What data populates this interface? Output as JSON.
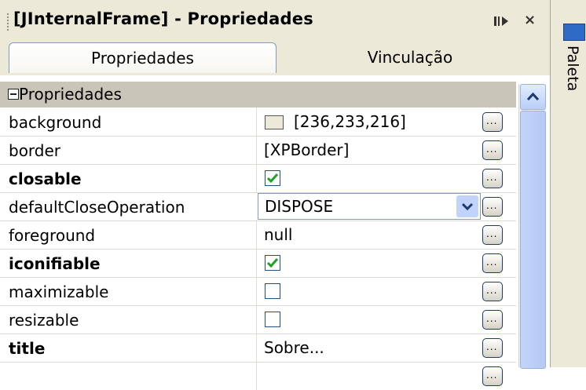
{
  "window": {
    "title": "[JInternalFrame] - Propriedades",
    "controls": {
      "minimize_icon": "minimize-dock-icon",
      "close_label": "×"
    }
  },
  "tabs": [
    {
      "label": "Propriedades",
      "active": true
    },
    {
      "label": "Vinculação",
      "active": false
    }
  ],
  "category": {
    "label": "Propriedades",
    "expanded": true
  },
  "properties": [
    {
      "name": "background",
      "bold": false,
      "kind": "color",
      "value": "[236,233,216]",
      "swatch": "#ece9d8"
    },
    {
      "name": "border",
      "bold": false,
      "kind": "text",
      "value": "[XPBorder]"
    },
    {
      "name": "closable",
      "bold": true,
      "kind": "checkbox",
      "checked": true
    },
    {
      "name": "defaultCloseOperation",
      "bold": false,
      "kind": "combo",
      "value": "DISPOSE"
    },
    {
      "name": "foreground",
      "bold": false,
      "kind": "text",
      "value": "null"
    },
    {
      "name": "iconifiable",
      "bold": true,
      "kind": "checkbox",
      "checked": true
    },
    {
      "name": "maximizable",
      "bold": false,
      "kind": "checkbox",
      "checked": false
    },
    {
      "name": "resizable",
      "bold": false,
      "kind": "checkbox",
      "checked": false
    },
    {
      "name": "title",
      "bold": true,
      "kind": "text",
      "value": "Sobre..."
    }
  ],
  "sidebar": {
    "label": "Paleta",
    "icon": "palette-icon"
  },
  "colors": {
    "panel_bg": "#ece9d8",
    "category_bg": "#c9c5b8",
    "scroll": "#b5c9f4",
    "check": "#21a121"
  }
}
